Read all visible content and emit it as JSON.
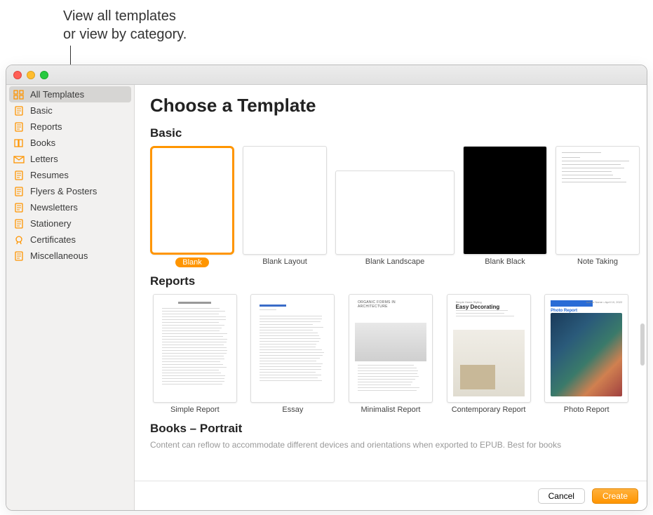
{
  "callout": "View all templates\nor view by category.",
  "sidebar": {
    "items": [
      {
        "label": "All Templates",
        "icon": "grid",
        "selected": true
      },
      {
        "label": "Basic",
        "icon": "doc"
      },
      {
        "label": "Reports",
        "icon": "doc-lines"
      },
      {
        "label": "Books",
        "icon": "book"
      },
      {
        "label": "Letters",
        "icon": "envelope"
      },
      {
        "label": "Resumes",
        "icon": "person-doc"
      },
      {
        "label": "Flyers & Posters",
        "icon": "poster"
      },
      {
        "label": "Newsletters",
        "icon": "news"
      },
      {
        "label": "Stationery",
        "icon": "card"
      },
      {
        "label": "Certificates",
        "icon": "seal"
      },
      {
        "label": "Miscellaneous",
        "icon": "misc"
      }
    ]
  },
  "main": {
    "title": "Choose a Template",
    "sections": [
      {
        "title": "Basic",
        "templates": [
          {
            "label": "Blank",
            "kind": "blank",
            "selected": true
          },
          {
            "label": "Blank Layout",
            "kind": "blank"
          },
          {
            "label": "Blank Landscape",
            "kind": "blank",
            "landscape": true
          },
          {
            "label": "Blank Black",
            "kind": "black"
          },
          {
            "label": "Note Taking",
            "kind": "notes"
          }
        ]
      },
      {
        "title": "Reports",
        "templates": [
          {
            "label": "Simple Report",
            "kind": "text-dense",
            "heading": "Simple Report"
          },
          {
            "label": "Essay",
            "kind": "essay",
            "heading": "Essay Title"
          },
          {
            "label": "Minimalist Report",
            "kind": "arch",
            "heading": "ORGANIC FORMS IN ARCHITECTURE"
          },
          {
            "label": "Contemporary Report",
            "kind": "decor",
            "heading": "Easy Decorating"
          },
          {
            "label": "Photo Report",
            "kind": "photo",
            "heading": "Photo Report"
          }
        ]
      },
      {
        "title": "Books – Portrait",
        "subtitle": "Content can reflow to accommodate different devices and orientations when exported to EPUB. Best for books",
        "templates": []
      }
    ]
  },
  "footer": {
    "cancel": "Cancel",
    "create": "Create"
  }
}
